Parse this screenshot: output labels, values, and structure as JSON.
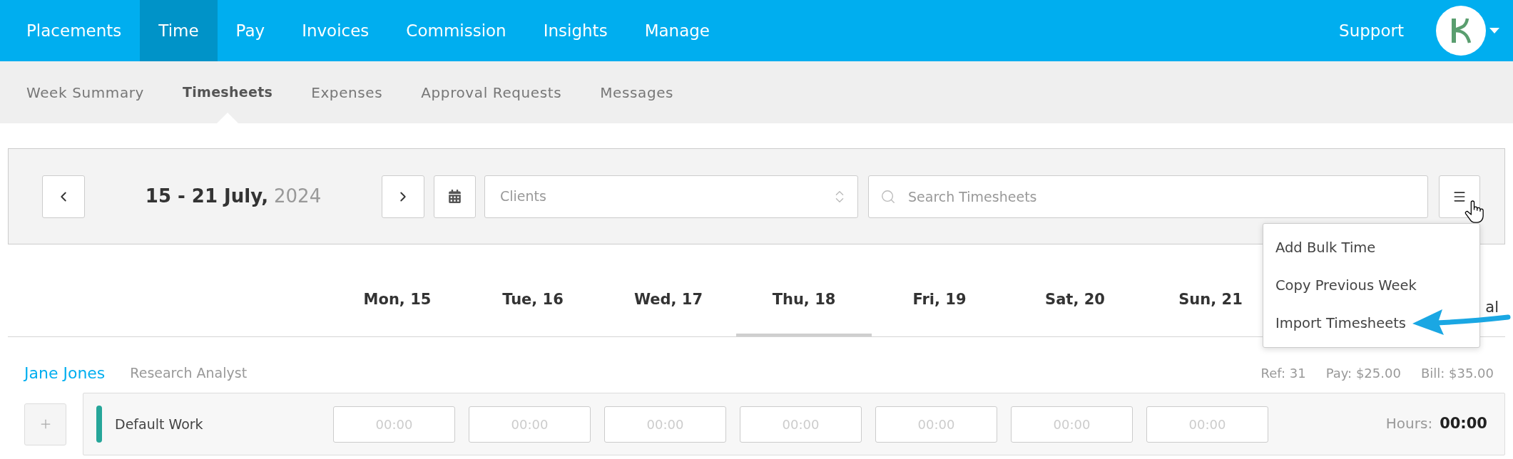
{
  "top_nav": {
    "items": [
      {
        "label": "Placements",
        "selected": false
      },
      {
        "label": "Time",
        "selected": true
      },
      {
        "label": "Pay",
        "selected": false
      },
      {
        "label": "Invoices",
        "selected": false
      },
      {
        "label": "Commission",
        "selected": false
      },
      {
        "label": "Insights",
        "selected": false
      },
      {
        "label": "Manage",
        "selected": false
      }
    ],
    "support": "Support"
  },
  "sub_nav": {
    "items": [
      {
        "label": "Week Summary",
        "selected": false
      },
      {
        "label": "Timesheets",
        "selected": true
      },
      {
        "label": "Expenses",
        "selected": false
      },
      {
        "label": "Approval Requests",
        "selected": false
      },
      {
        "label": "Messages",
        "selected": false
      }
    ]
  },
  "toolbar": {
    "date_range": "15 - 21 July,",
    "year": "2024",
    "clients_select": {
      "placeholder": "Clients"
    },
    "search": {
      "placeholder": "Search Timesheets"
    }
  },
  "menu": {
    "items": [
      "Add Bulk Time",
      "Copy Previous Week",
      "Import Timesheets"
    ]
  },
  "days": [
    {
      "label": "Mon, 15",
      "selected": false
    },
    {
      "label": "Tue, 16",
      "selected": false
    },
    {
      "label": "Wed, 17",
      "selected": false
    },
    {
      "label": "Thu, 18",
      "selected": true
    },
    {
      "label": "Fri, 19",
      "selected": false
    },
    {
      "label": "Sat, 20",
      "selected": false
    },
    {
      "label": "Sun, 21",
      "selected": false
    }
  ],
  "total_header": "al",
  "placements": [
    {
      "name": "Jane Jones",
      "role": "Research Analyst",
      "ref": "Ref: 31",
      "pay": "Pay: $25.00",
      "bill": "Bill: $35.00",
      "rows": [
        {
          "label": "Default Work",
          "color": "#26a69a",
          "entries": [
            {
              "placeholder": "00:00"
            },
            {
              "placeholder": "00:00"
            },
            {
              "placeholder": "00:00"
            },
            {
              "placeholder": "00:00"
            },
            {
              "placeholder": "00:00"
            },
            {
              "placeholder": "00:00"
            },
            {
              "placeholder": "00:00"
            }
          ],
          "hours_label": "Hours:",
          "hours": "00:00"
        }
      ]
    }
  ]
}
